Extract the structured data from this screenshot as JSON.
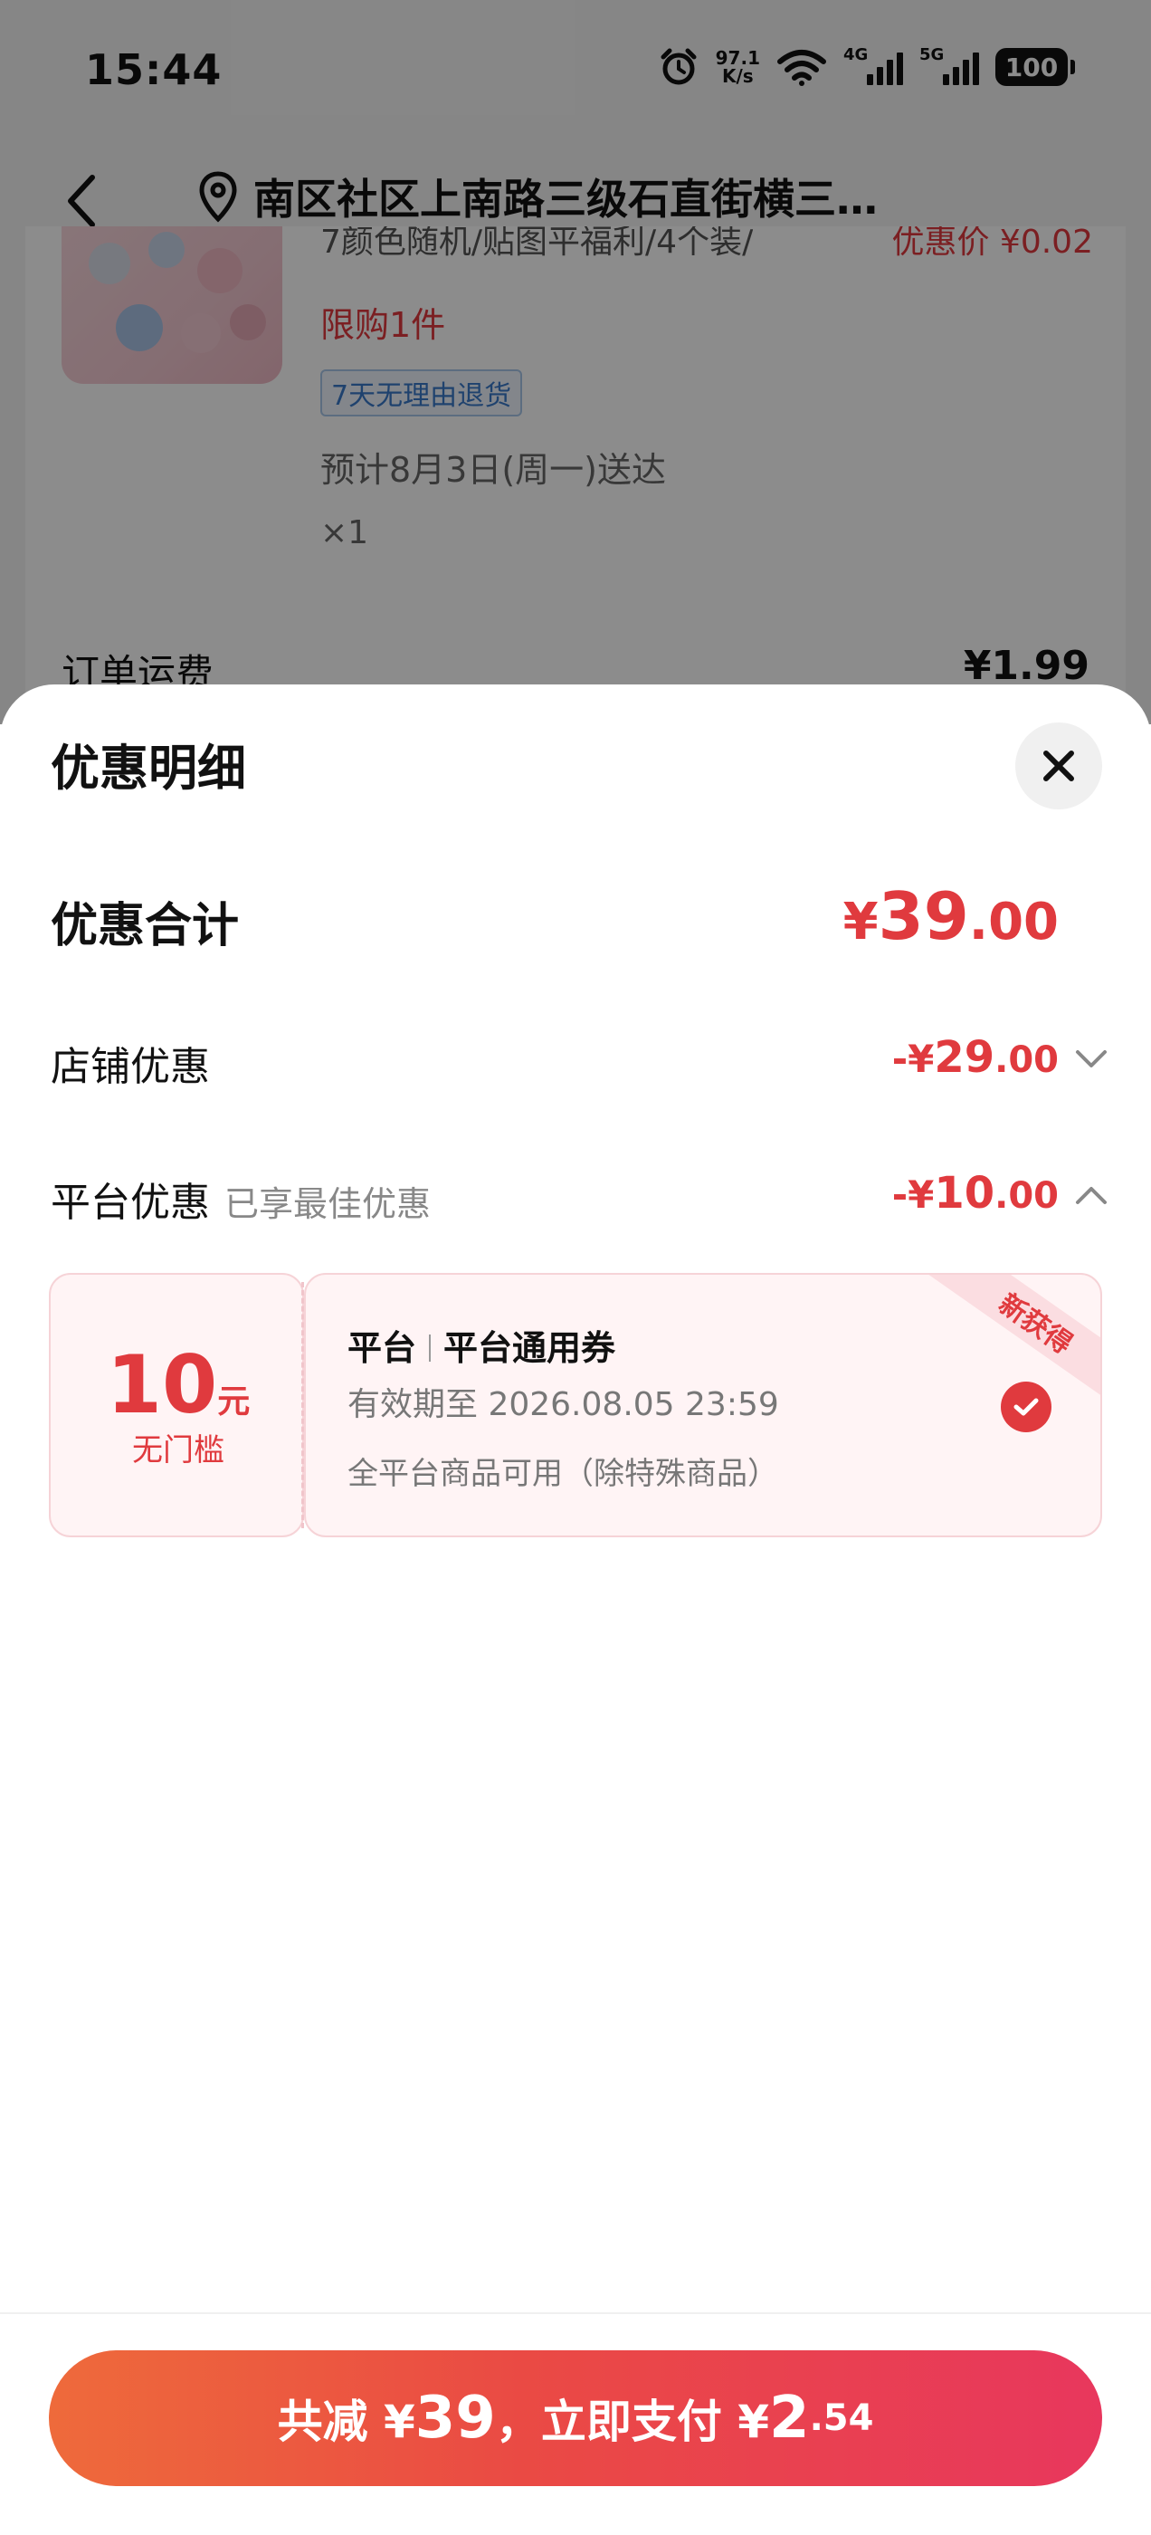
{
  "status_bar": {
    "time": "15:44",
    "net_speed_value": "97.1",
    "net_speed_unit": "K/s",
    "signal1_label": "4G",
    "signal2_label": "5G",
    "battery": "100"
  },
  "nav": {
    "address": "南区社区上南路三级石直街横三…"
  },
  "order": {
    "product_desc": "7颜色随机/贴图平福利/4个装/",
    "promo_price": "优惠价 ¥0.02",
    "limit": "限购1件",
    "return_tag": "7天无理由退货",
    "delivery": "预计8月3日(周一)送达",
    "quantity": "×1",
    "shipping_label": "订单运费",
    "shipping_price": "¥1.99"
  },
  "sheet": {
    "title": "优惠明细",
    "total": {
      "label": "优惠合计",
      "symbol": "¥",
      "integer": "39",
      "decimal": ".00"
    },
    "store": {
      "label": "店铺优惠",
      "symbol": "-¥",
      "integer": "29",
      "decimal": ".00",
      "expanded": false
    },
    "platform": {
      "label": "平台优惠",
      "note": "已享最佳优惠",
      "symbol": "-¥",
      "integer": "10",
      "decimal": ".00",
      "expanded": true
    },
    "coupon": {
      "amount": "10",
      "unit": "元",
      "condition": "无门槛",
      "source": "平台",
      "name": "平台通用券",
      "validity": "有效期至 2026.08.05 23:59",
      "scope": "全平台商品可用（除特殊商品）",
      "badge": "新获得",
      "selected": true
    }
  },
  "footer": {
    "prefix": "共减 ¥",
    "reduce": "39",
    "middle": "，立即支付 ¥",
    "pay_int": "2",
    "pay_dec": ".54"
  },
  "colors": {
    "accent": "#e03a3e",
    "button_gradient_start": "#ee6a3b",
    "button_gradient_end": "#e8375d"
  }
}
